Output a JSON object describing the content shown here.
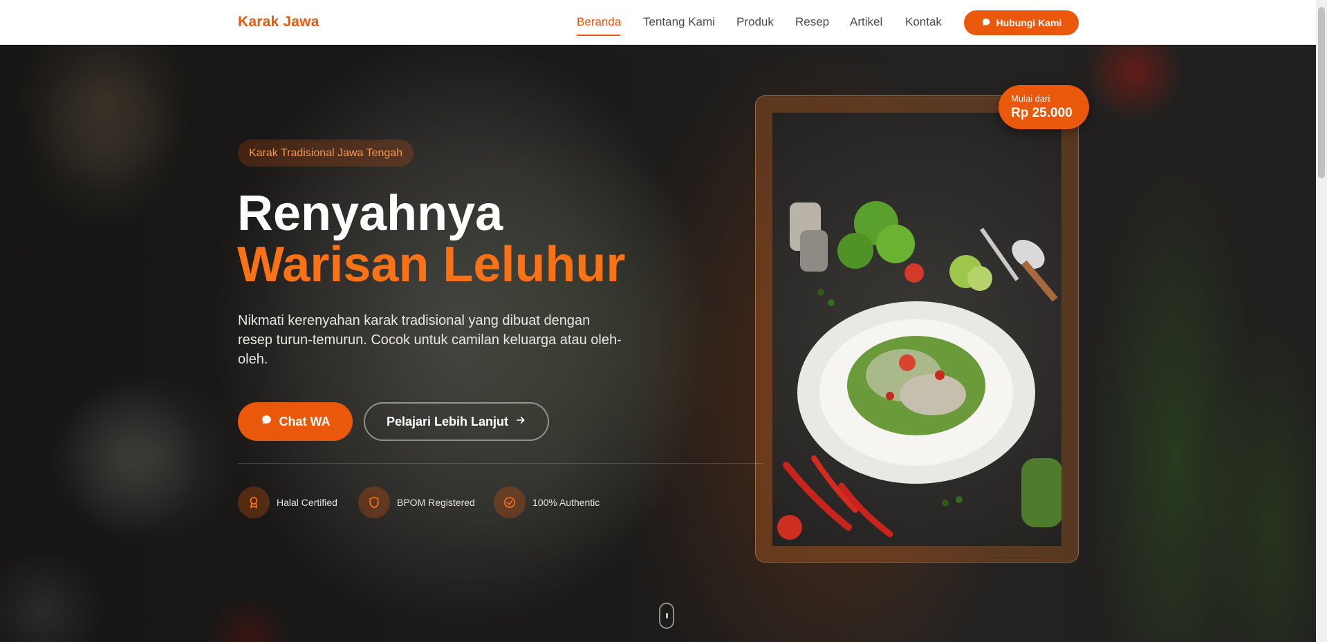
{
  "brand": "Karak Jawa",
  "nav": {
    "items": [
      {
        "label": "Beranda",
        "active": true
      },
      {
        "label": "Tentang Kami",
        "active": false
      },
      {
        "label": "Produk",
        "active": false
      },
      {
        "label": "Resep",
        "active": false
      },
      {
        "label": "Artikel",
        "active": false
      },
      {
        "label": "Kontak",
        "active": false
      }
    ],
    "cta_label": "Hubungi Kami",
    "cta_icon": "chat-bubble-icon"
  },
  "hero": {
    "badge": "Karak Tradisional Jawa Tengah",
    "title_line1": "Renyahnya",
    "title_line2": "Warisan Leluhur",
    "description": "Nikmati kerenyahan karak tradisional yang dibuat dengan resep turun-temurun. Cocok untuk camilan keluarga atau oleh-oleh.",
    "primary_button": "Chat WA",
    "secondary_button": "Pelajari Lebih Lanjut",
    "features": [
      {
        "label": "Halal Certified",
        "icon": "award-ribbon-icon"
      },
      {
        "label": "BPOM Registered",
        "icon": "shield-icon"
      },
      {
        "label": "100% Authentic",
        "icon": "check-circle-icon"
      }
    ]
  },
  "price_badge": {
    "label": "Mulai dari",
    "value": "Rp 25.000"
  },
  "colors": {
    "accent": "#ea580c",
    "accent_light": "#f97316",
    "nav_text": "#4b4b4b",
    "hero_text": "#ffffff"
  }
}
